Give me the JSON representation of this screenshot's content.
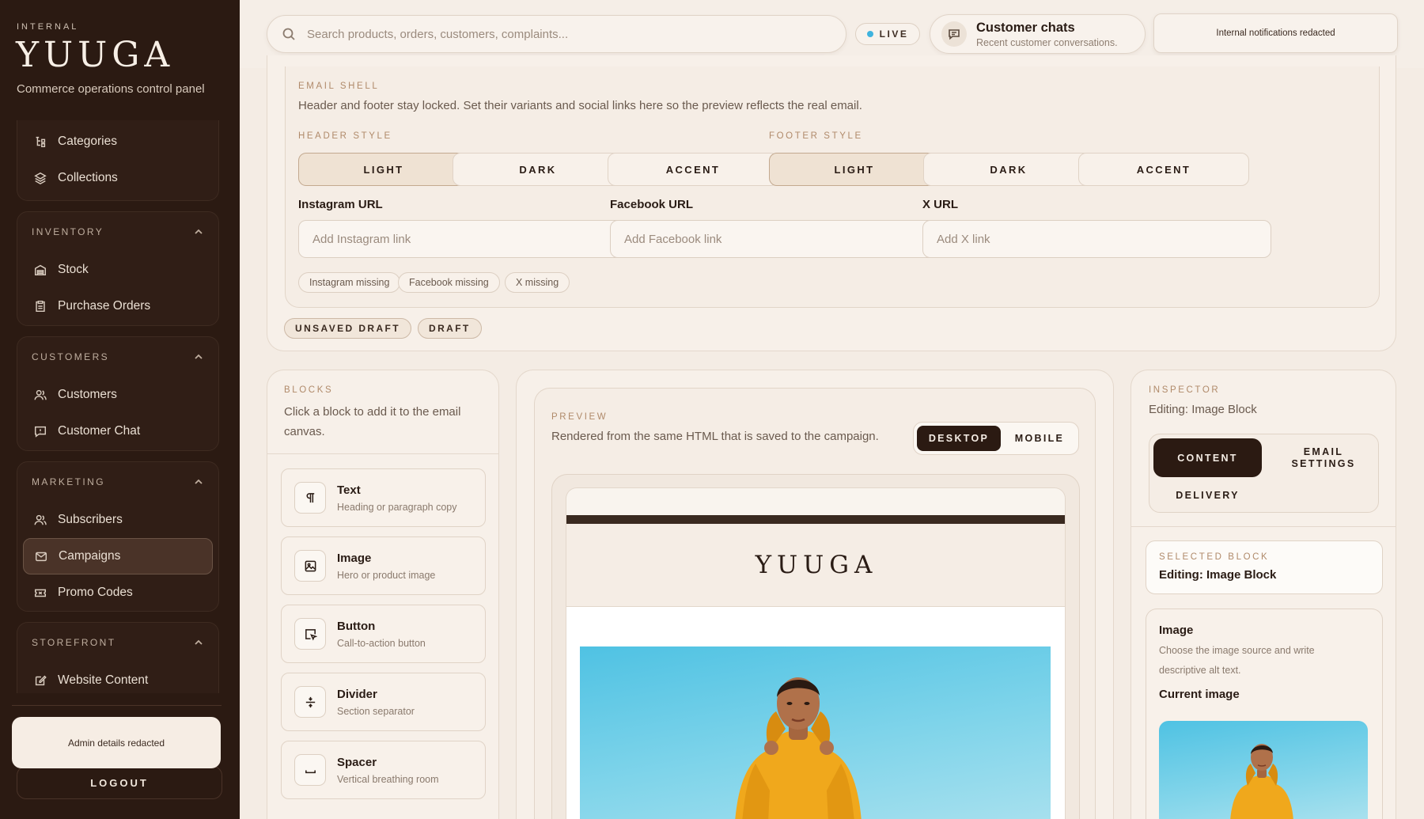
{
  "sidebar": {
    "eyebrow": "INTERNAL",
    "brand": "YUUGA",
    "subtitle": "Commerce operations control panel",
    "top_items": [
      {
        "label": "Categories",
        "icon": "categories-icon"
      },
      {
        "label": "Collections",
        "icon": "collections-icon"
      }
    ],
    "groups": [
      {
        "title": "INVENTORY",
        "items": [
          {
            "label": "Stock",
            "icon": "warehouse-icon"
          },
          {
            "label": "Purchase Orders",
            "icon": "clipboard-icon"
          }
        ]
      },
      {
        "title": "CUSTOMERS",
        "items": [
          {
            "label": "Customers",
            "icon": "users-icon"
          },
          {
            "label": "Customer Chat",
            "icon": "chat-icon"
          }
        ]
      },
      {
        "title": "MARKETING",
        "items": [
          {
            "label": "Subscribers",
            "icon": "users-icon"
          },
          {
            "label": "Campaigns",
            "icon": "mail-icon",
            "active": true
          },
          {
            "label": "Promo Codes",
            "icon": "ticket-icon"
          }
        ]
      },
      {
        "title": "STOREFRONT",
        "items": [
          {
            "label": "Website Content",
            "icon": "edit-icon"
          }
        ]
      }
    ],
    "admin_text": "Admin details redacted",
    "logout_label": "LOGOUT"
  },
  "topbar": {
    "search_placeholder": "Search products, orders, customers, complaints...",
    "live_label": "LIVE",
    "chats_title": "Customer chats",
    "chats_subtitle": "Recent customer conversations.",
    "notifications_text": "Internal notifications redacted"
  },
  "email_shell": {
    "eyebrow": "EMAIL SHELL",
    "description": "Header and footer stay locked. Set their variants and social links here so the preview reflects the real email.",
    "header_style_label": "HEADER STYLE",
    "footer_style_label": "FOOTER STYLE",
    "header_options": [
      "LIGHT",
      "DARK",
      "ACCENT"
    ],
    "footer_options": [
      "LIGHT",
      "DARK",
      "ACCENT"
    ],
    "header_selected": "LIGHT",
    "footer_selected": "LIGHT",
    "instagram_label": "Instagram URL",
    "instagram_placeholder": "Add Instagram link",
    "facebook_label": "Facebook URL",
    "facebook_placeholder": "Add Facebook link",
    "x_label": "X URL",
    "x_placeholder": "Add X link",
    "missing_chips": [
      "Instagram missing",
      "Facebook missing",
      "X missing"
    ],
    "status_chips": [
      "UNSAVED DRAFT",
      "DRAFT"
    ]
  },
  "blocks": {
    "eyebrow": "BLOCKS",
    "description": "Click a block to add it to the email canvas.",
    "items": [
      {
        "title": "Text",
        "desc": "Heading or paragraph copy",
        "icon": "pilcrow-icon"
      },
      {
        "title": "Image",
        "desc": "Hero or product image",
        "icon": "image-icon"
      },
      {
        "title": "Button",
        "desc": "Call-to-action button",
        "icon": "cursor-button-icon"
      },
      {
        "title": "Divider",
        "desc": "Section separator",
        "icon": "divider-icon"
      },
      {
        "title": "Spacer",
        "desc": "Vertical breathing room",
        "icon": "spacer-icon"
      }
    ]
  },
  "preview": {
    "eyebrow": "PREVIEW",
    "description": "Rendered from the same HTML that is saved to the campaign.",
    "desktop_label": "DESKTOP",
    "mobile_label": "MOBILE",
    "email_brand": "YUUGA"
  },
  "inspector": {
    "eyebrow": "INSPECTOR",
    "editing": "Editing: Image Block",
    "tab_content": "CONTENT",
    "tab_email_settings_1": "EMAIL",
    "tab_email_settings_2": "SETTINGS",
    "tab_delivery": "DELIVERY",
    "selected_block_eyebrow": "SELECTED BLOCK",
    "selected_block_title": "Editing: Image Block",
    "image_title": "Image",
    "image_desc": "Choose the image source and write descriptive alt text.",
    "current_image_label": "Current image"
  },
  "colors": {
    "sidebar_bg": "#2b1a12",
    "page_bg": "#f4ece4",
    "accent_eyebrow": "#b08a6a",
    "live_dot": "#3fb3de",
    "hero_sky": "#4fc2e3",
    "hoodie_yellow": "#f0a81c"
  }
}
